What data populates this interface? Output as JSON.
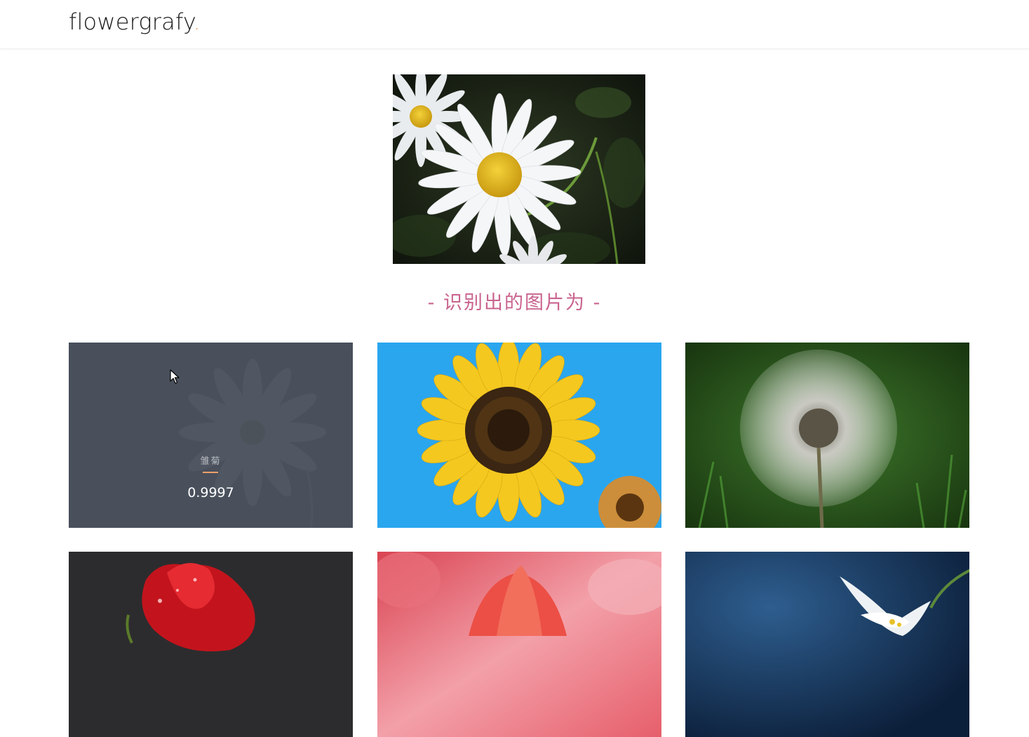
{
  "header": {
    "logo_text": "flowergrafy",
    "logo_dot": "."
  },
  "main": {
    "result_title": "- 识别出的图片为 -"
  },
  "results": [
    {
      "name": "雏菊",
      "score": "0.9997",
      "overlay_visible": true
    },
    {
      "name": "",
      "score": "",
      "overlay_visible": false
    },
    {
      "name": "",
      "score": "",
      "overlay_visible": false
    },
    {
      "name": "",
      "score": "",
      "overlay_visible": false
    },
    {
      "name": "",
      "score": "",
      "overlay_visible": false
    },
    {
      "name": "",
      "score": "",
      "overlay_visible": false
    }
  ],
  "colors": {
    "accent": "#f0a06a",
    "title": "#c9638e",
    "overlay": "#464d58"
  }
}
